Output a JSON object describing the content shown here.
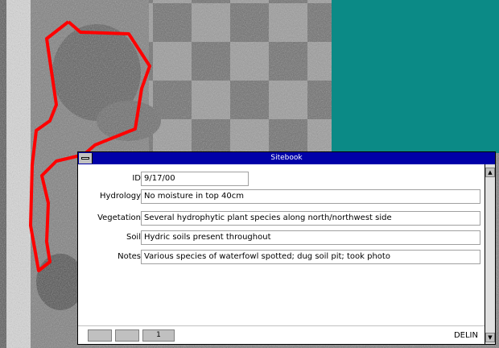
{
  "window": {
    "title": "Sitebook"
  },
  "record": {
    "fields": [
      {
        "label": "ID",
        "value": "9/17/00"
      },
      {
        "label": "Hydrology",
        "value": "No moisture in top 40cm"
      },
      {
        "label": "Vegetation",
        "value": "Several hydrophytic plant species along north/northwest side"
      },
      {
        "label": "Soil",
        "value": "Hydric soils present throughout"
      },
      {
        "label": "Notes",
        "value": "Various species of waterfowl spotted; dug soil pit; took photo"
      }
    ]
  },
  "navigation": {
    "buttons": [
      "",
      "",
      "1"
    ]
  },
  "status": {
    "text": "DELIN"
  },
  "colors": {
    "boundary": "#ff0000",
    "titlebar": "#0000a8",
    "teal_panel": "#0b8a86"
  }
}
